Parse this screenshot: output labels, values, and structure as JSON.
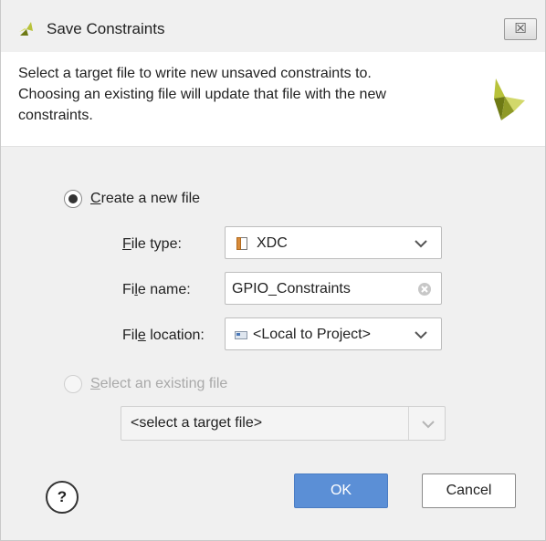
{
  "window": {
    "title": "Save Constraints",
    "close_glyph": "☒"
  },
  "header": {
    "message_lines": [
      "Select a target file to write new unsaved constraints to.",
      "Choosing an existing file will update that file with the new",
      "constraints."
    ]
  },
  "options": {
    "create_new": {
      "label": "Create a new file",
      "mnemonic": "C",
      "rest": "reate a new file",
      "selected": true
    },
    "select_existing": {
      "label": "Select an existing file",
      "mnemonic": "S",
      "rest": "elect an existing file",
      "selected": false,
      "enabled": false
    }
  },
  "form": {
    "file_type": {
      "label_pre": "",
      "mnemonic": "F",
      "label_post": "ile type:",
      "value": "XDC",
      "icon": "xdc-file-icon"
    },
    "file_name": {
      "label_pre": "Fi",
      "mnemonic": "l",
      "label_post": "e name:",
      "value": "GPIO_Constraints"
    },
    "file_location": {
      "label_pre": "Fil",
      "mnemonic": "e",
      "label_post": " location:",
      "value": "<Local to Project>",
      "icon": "project-location-icon"
    }
  },
  "existing_file_select": {
    "value": "<select a target file>"
  },
  "buttons": {
    "help": "?",
    "ok": "OK",
    "cancel": "Cancel"
  },
  "colors": {
    "ok_button": "#5b8fd6",
    "logo_primary": "#b8c23a",
    "logo_secondary": "#6e7a14"
  }
}
